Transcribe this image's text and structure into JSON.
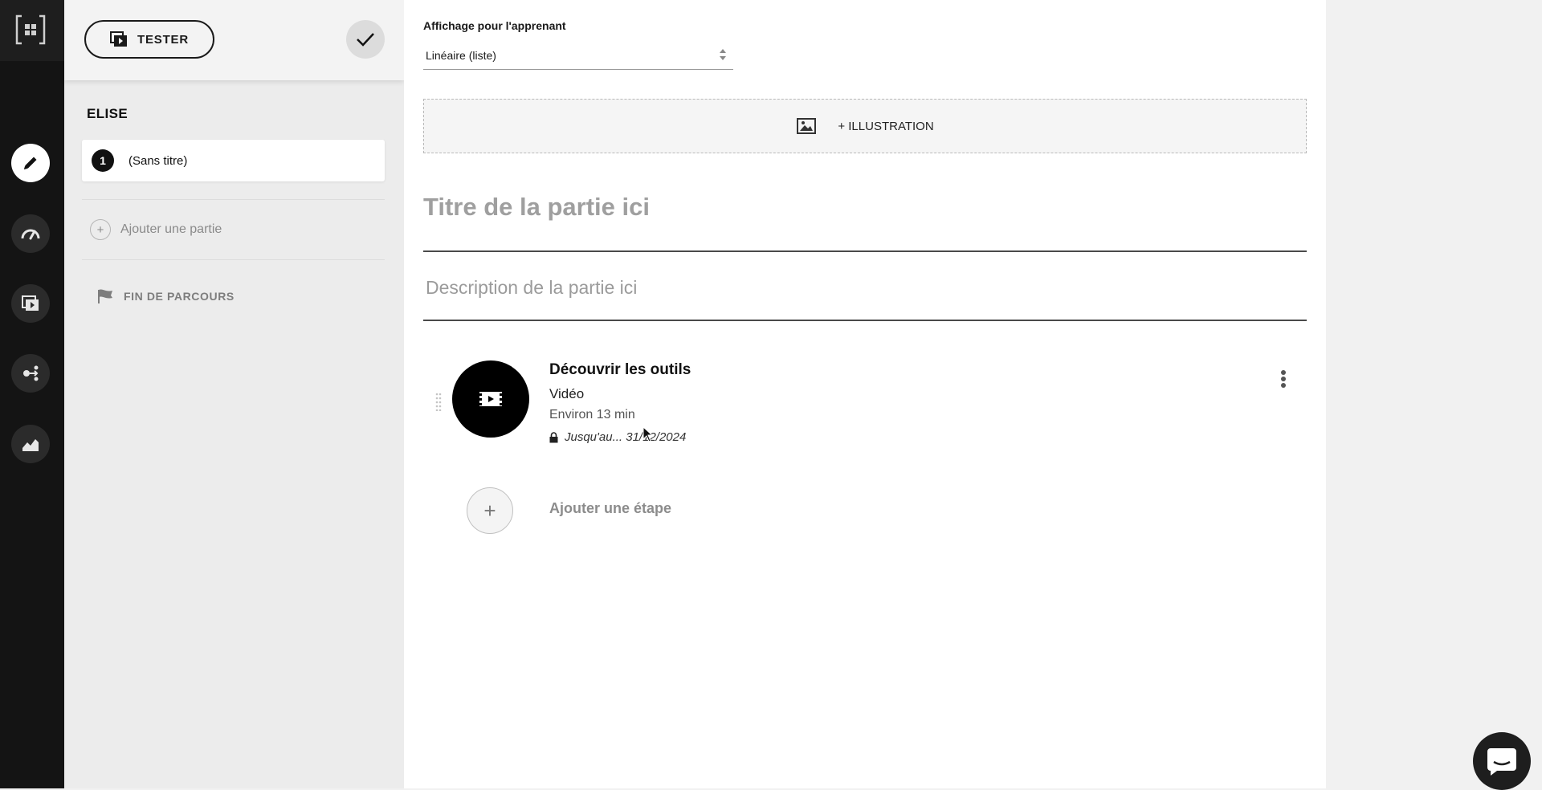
{
  "rail": {
    "items": [
      {
        "icon": "pencil-icon",
        "active": true
      },
      {
        "icon": "gauge-icon",
        "active": false
      },
      {
        "icon": "media-stack-icon",
        "active": false
      },
      {
        "icon": "share-nodes-icon",
        "active": false
      },
      {
        "icon": "area-chart-icon",
        "active": false
      }
    ]
  },
  "sidebar": {
    "tester_label": "TESTER",
    "course_name": "ELISE",
    "parts": [
      {
        "number": "1",
        "title": "(Sans titre)"
      }
    ],
    "add_part_label": "Ajouter une partie",
    "end_label": "FIN DE PARCOURS"
  },
  "main": {
    "display_label": "Affichage pour l'apprenant",
    "display_value": "Linéaire (liste)",
    "illustration_label": "+ ILLUSTRATION",
    "title_placeholder": "Titre de la partie ici",
    "description_placeholder": "Description de la partie ici",
    "step": {
      "title": "Découvrir les outils",
      "type": "Vidéo",
      "duration": "Environ 13 min",
      "availability": "Jusqu'au... 31/12/2024"
    },
    "add_step_label": "Ajouter une étape"
  },
  "colors": {
    "rail_bg": "#141414",
    "sidebar_bg": "#ececec",
    "main_bg": "#ffffff",
    "accent": "#000000"
  }
}
